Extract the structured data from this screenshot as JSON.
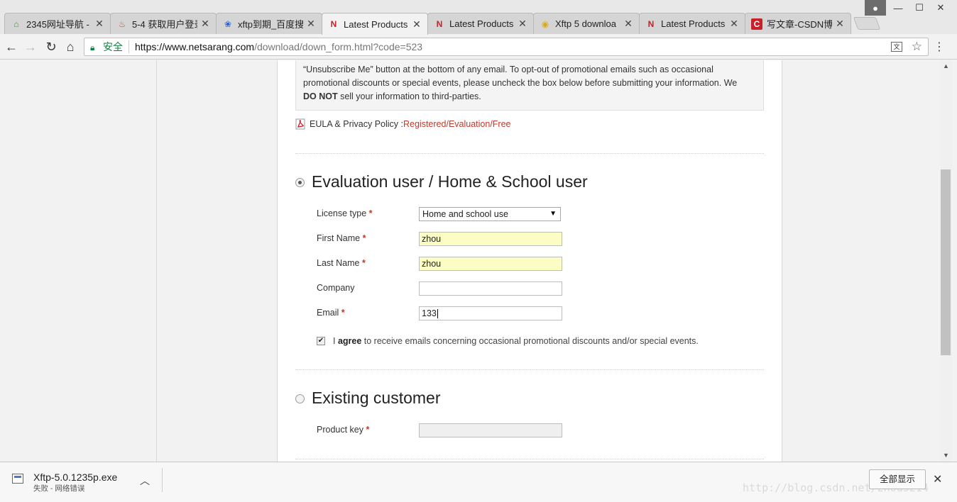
{
  "tabs": [
    {
      "title": "2345网址导航 -",
      "icon": "2345",
      "icon_color": "#3a9a3a"
    },
    {
      "title": "5-4 获取用户登录",
      "icon": "flame",
      "icon_color": "#e24a2a"
    },
    {
      "title": "xftp到期_百度搜",
      "icon": "paw",
      "icon_color": "#2d62d6"
    },
    {
      "title": "Latest Products",
      "icon": "N",
      "icon_color": "#c9202a",
      "active": true
    },
    {
      "title": "Latest Products",
      "icon": "N",
      "icon_color": "#c9202a"
    },
    {
      "title": "Xftp 5 downloa",
      "icon": "chrome",
      "icon_color": "#dbab1a"
    },
    {
      "title": "Latest Products",
      "icon": "N",
      "icon_color": "#c9202a"
    },
    {
      "title": "写文章-CSDN博",
      "icon": "C",
      "icon_color": "#c9202a"
    }
  ],
  "toolbar": {
    "secure_label": "安全",
    "url_host": "https://www.netsarang.com",
    "url_path": "/download/down_form.html?code=523"
  },
  "notice": {
    "line1": "“Unsubscribe Me” button at the bottom of any email. To opt-out of promotional emails such as occasional",
    "line2": "promotional discounts or special events, please uncheck the box below before submitting your information. We",
    "line3_bold": "DO NOT",
    "line3_rest": " sell your information to third-parties."
  },
  "eula": {
    "label": "EULA & Privacy Policy : ",
    "link_registered": "Registered",
    "link_evaluation": "Evaluation",
    "link_free": "Free",
    "sep": " / "
  },
  "evaluation": {
    "title": "Evaluation user / Home & School user",
    "selected": true,
    "license_label": "License type",
    "license_value": "Home and school use",
    "first_name_label": "First Name",
    "first_name_value": "zhou",
    "last_name_label": "Last Name",
    "last_name_value": "zhou",
    "company_label": "Company",
    "company_value": "",
    "email_label": "Email",
    "email_value": "133",
    "required_mark": "*",
    "agree_prefix": "I ",
    "agree_bold": "agree",
    "agree_rest": " to receive emails concerning occasional promotional discounts and/or special events.",
    "agree_checked": true,
    "agree_check_glyph": "✔"
  },
  "existing": {
    "title": "Existing customer",
    "selected": false,
    "product_key_label": "Product key",
    "product_key_value": ""
  },
  "download_shelf": {
    "filename": "Xftp-5.0.1235p.exe",
    "status": "失败 - 网络错误",
    "show_all_label": "全部显示",
    "watermark": "http://blog.csdn.net/zhou3214"
  }
}
